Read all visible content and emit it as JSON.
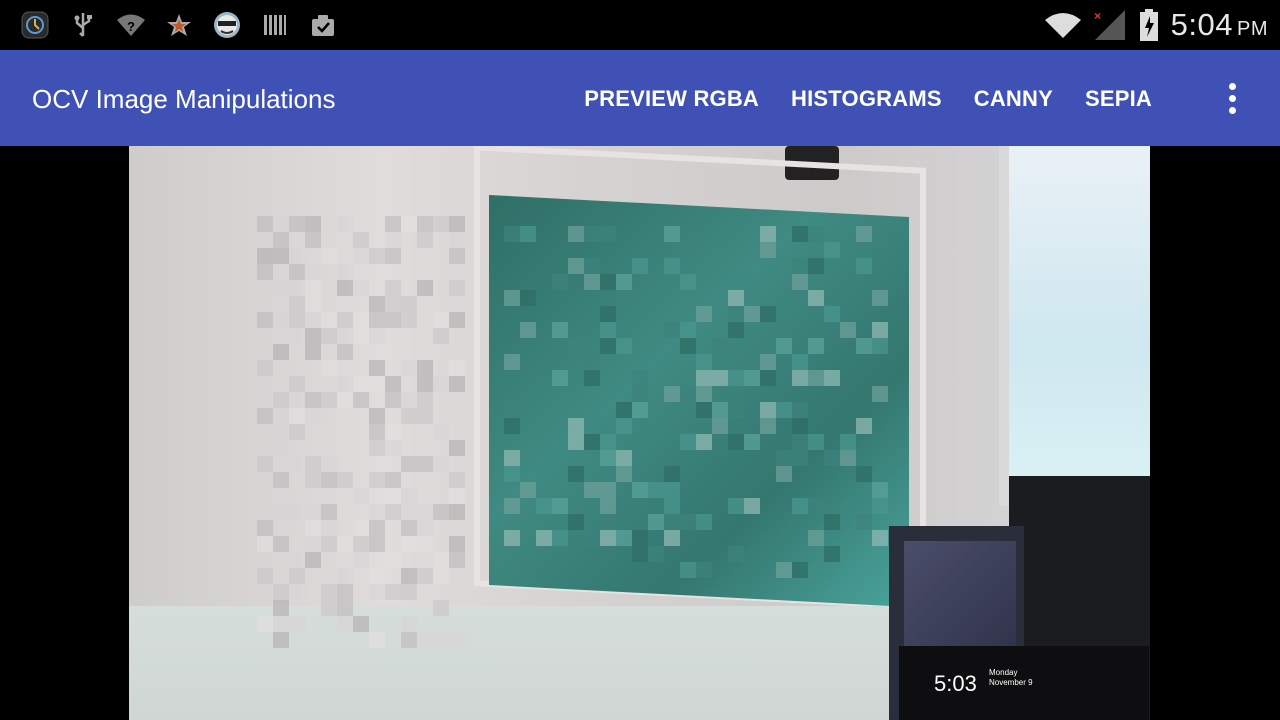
{
  "status_bar": {
    "left_icons": [
      {
        "name": "app-icon"
      },
      {
        "name": "usb-icon"
      },
      {
        "name": "wifi-question-icon"
      },
      {
        "name": "star-icon"
      },
      {
        "name": "app-face-icon"
      },
      {
        "name": "barcode-icon"
      },
      {
        "name": "clipboard-check-icon"
      }
    ],
    "right_icons": [
      {
        "name": "wifi-icon"
      },
      {
        "name": "signal-no-service-icon"
      },
      {
        "name": "battery-charging-icon"
      }
    ],
    "time": "5:04",
    "ampm": "PM"
  },
  "action_bar": {
    "title": "OCV Image Manipulations",
    "actions": [
      {
        "label": "PREVIEW RGBA"
      },
      {
        "label": "HISTOGRAMS"
      },
      {
        "label": "CANNY"
      },
      {
        "label": "SEPIA"
      }
    ],
    "overflow_icon": "more-vert-icon"
  },
  "preview": {
    "clock_time": "5:03",
    "clock_day": "Monday",
    "clock_date": "November 9"
  },
  "colors": {
    "action_bar": "#3f51b5",
    "status_bar": "#000000",
    "board": "#3f8a82"
  }
}
